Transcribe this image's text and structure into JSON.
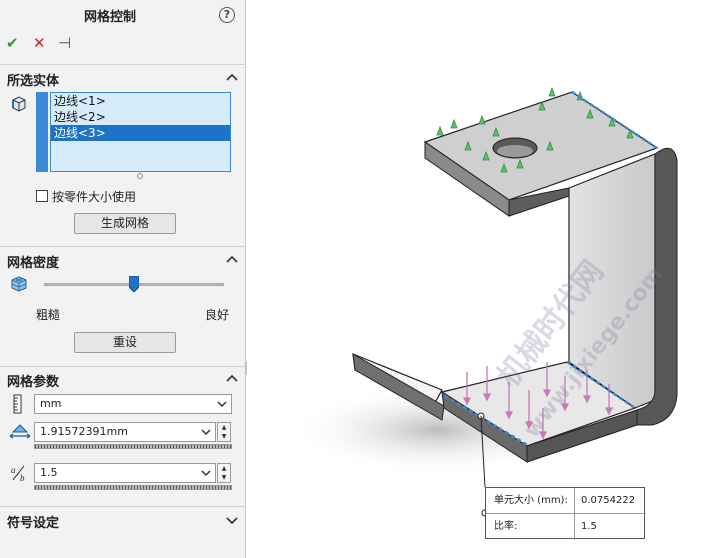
{
  "panel": {
    "title": "网格控制",
    "help_symbol": "?",
    "actions": {
      "ok": "✔",
      "cancel": "✕",
      "pin": "⊣"
    },
    "selected_entities": {
      "heading": "所选实体",
      "items": [
        "边线<1>",
        "边线<2>",
        "边线<3>"
      ],
      "active_index": 2,
      "use_part_size_label": "按零件大小使用",
      "use_part_size_checked": false,
      "create_mesh_button": "生成网格"
    },
    "mesh_density": {
      "heading": "网格密度",
      "slider_value": 0.5,
      "coarse_label": "粗糙",
      "fine_label": "良好",
      "reset_button": "重设"
    },
    "mesh_params": {
      "heading": "网格参数",
      "unit": "mm",
      "element_size": "1.91572391mm",
      "ratio": "1.5",
      "ratio_icon": "a/b"
    },
    "symbol_settings": {
      "heading": "符号设定"
    }
  },
  "viewport": {
    "callout": {
      "element_size_label": "单元大小 (mm):",
      "element_size_value": "0.0754222",
      "ratio_label": "比率:",
      "ratio_value": "1.5"
    },
    "watermark_cn": "机械时代网",
    "watermark_en": "www.jixiege.com"
  },
  "colors": {
    "selection": "#1e73c8",
    "ok": "#2f9d2f",
    "cancel": "#d92020",
    "edge_highlight": "#3a8ad8"
  }
}
